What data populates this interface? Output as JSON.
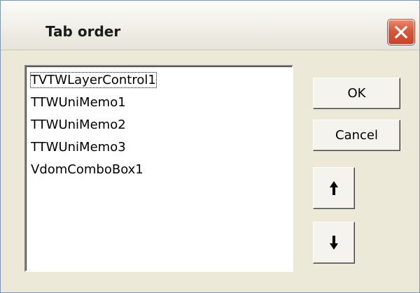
{
  "window": {
    "title": "Tab order"
  },
  "list": {
    "items": [
      {
        "label": "TVTWLayerControl1",
        "selected": true
      },
      {
        "label": "TTWUniMemo1",
        "selected": false
      },
      {
        "label": "TTWUniMemo2",
        "selected": false
      },
      {
        "label": "TTWUniMemo3",
        "selected": false
      },
      {
        "label": "VdomComboBox1",
        "selected": false
      }
    ]
  },
  "buttons": {
    "ok_label": "OK",
    "cancel_label": "Cancel",
    "move_up_icon": "arrow-up-icon",
    "move_down_icon": "arrow-down-icon"
  },
  "colors": {
    "close_button": "#d9563b",
    "dialog_background": "#ece9d8"
  }
}
